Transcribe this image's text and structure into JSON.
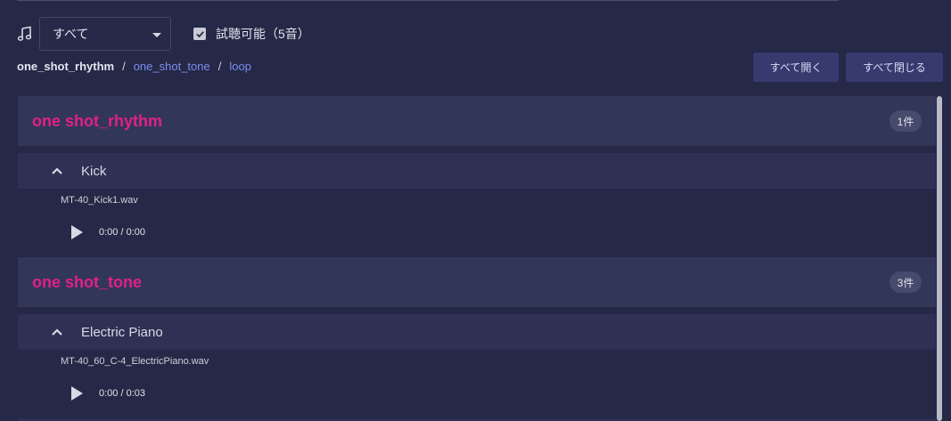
{
  "filter": {
    "select_value": "すべて",
    "checkbox_label": "試聴可能（5音）",
    "checkbox_checked": true
  },
  "breadcrumb": {
    "current": "one_shot_rhythm",
    "sep": "/",
    "links": [
      "one_shot_tone",
      "loop"
    ]
  },
  "toolbar": {
    "expand_all": "すべて開く",
    "collapse_all": "すべて閉じる"
  },
  "categories": [
    {
      "title": "one shot_rhythm",
      "count": "1件",
      "group": {
        "name": "Kick",
        "file": "MT-40_Kick1.wav",
        "time": "0:00 / 0:00"
      }
    },
    {
      "title": "one shot_tone",
      "count": "3件",
      "group": {
        "name": "Electric Piano",
        "file": "MT-40_60_C-4_ElectricPiano.wav",
        "time": "0:00 / 0:03"
      }
    }
  ],
  "colors": {
    "background": "#252846",
    "category_title": "#e0208a",
    "link": "#7d8df0",
    "button_bg": "#363a6e"
  },
  "icons": [
    "music-note-icon",
    "chevron-down-icon",
    "checkbox-checked-icon",
    "chevron-up-icon",
    "play-icon"
  ]
}
